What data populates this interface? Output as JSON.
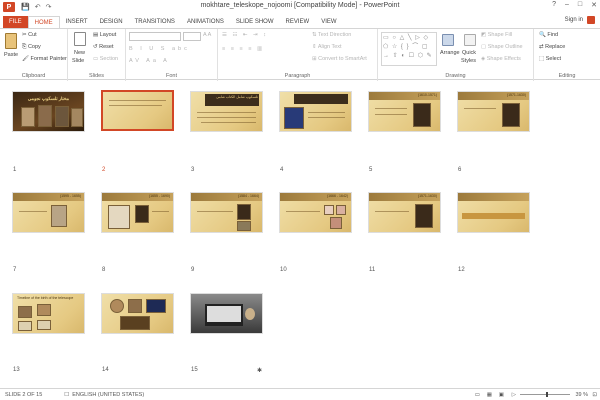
{
  "window": {
    "title": "mokhtare_teleskope_nojoomi [Compatibility Mode] - PowerPoint",
    "app_icon": "P",
    "signin": "Sign in",
    "controls": [
      "?",
      "–",
      "□",
      "✕"
    ]
  },
  "qat": {
    "save": "💾",
    "undo": "↶",
    "redo": "↷"
  },
  "tabs": [
    "FILE",
    "HOME",
    "INSERT",
    "DESIGN",
    "TRANSITIONS",
    "ANIMATIONS",
    "SLIDE SHOW",
    "REVIEW",
    "VIEW"
  ],
  "active_tab": "HOME",
  "ribbon": {
    "clipboard": {
      "label": "Clipboard",
      "paste": "Paste",
      "cut": "Cut",
      "copy": "Copy",
      "format_painter": "Format Painter"
    },
    "slides": {
      "label": "Slides",
      "new_slide": "New",
      "new_slide2": "Slide",
      "layout": "Layout",
      "reset": "Reset",
      "section": "Section"
    },
    "font": {
      "label": "Font"
    },
    "paragraph": {
      "label": "Paragraph",
      "text_direction": "Text Direction",
      "align_text": "Align Text",
      "convert_smartart": "Convert to SmartArt"
    },
    "drawing": {
      "label": "Drawing",
      "arrange": "Arrange",
      "quick_styles": "Quick",
      "quick_styles2": "Styles",
      "shape_fill": "Shape Fill",
      "shape_outline": "Shape Outline",
      "shape_effects": "Shape Effects"
    },
    "editing": {
      "label": "Editing",
      "find": "Find",
      "replace": "Replace",
      "select": "Select"
    }
  },
  "slides": [
    {
      "n": "1",
      "title": "مختار تلسکوپ نجومی"
    },
    {
      "n": "2"
    },
    {
      "n": "3",
      "title": "تلسکوپ شامل الكتاب شامی"
    },
    {
      "n": "4"
    },
    {
      "n": "5",
      "title": "(1610-1571)"
    },
    {
      "n": "6",
      "title": "(1571-1630)"
    },
    {
      "n": "7",
      "title": "(1595 - 1655)"
    },
    {
      "n": "8",
      "title": "(1655 - 1690)"
    },
    {
      "n": "9",
      "title": "(1584 - 1664)"
    },
    {
      "n": "10",
      "title": "(1666 - 1642)"
    },
    {
      "n": "11",
      "title": "(1571-1630)"
    },
    {
      "n": "12"
    },
    {
      "n": "13",
      "title": "Timeline of the birth of the telescope"
    },
    {
      "n": "14"
    },
    {
      "n": "15"
    }
  ],
  "selected_slide": "2",
  "status": {
    "slide_info": "SLIDE 2 OF 15",
    "language": "ENGLISH (UNITED STATES)",
    "zoom": "39 %"
  },
  "colors": {
    "accent": "#d24726"
  }
}
